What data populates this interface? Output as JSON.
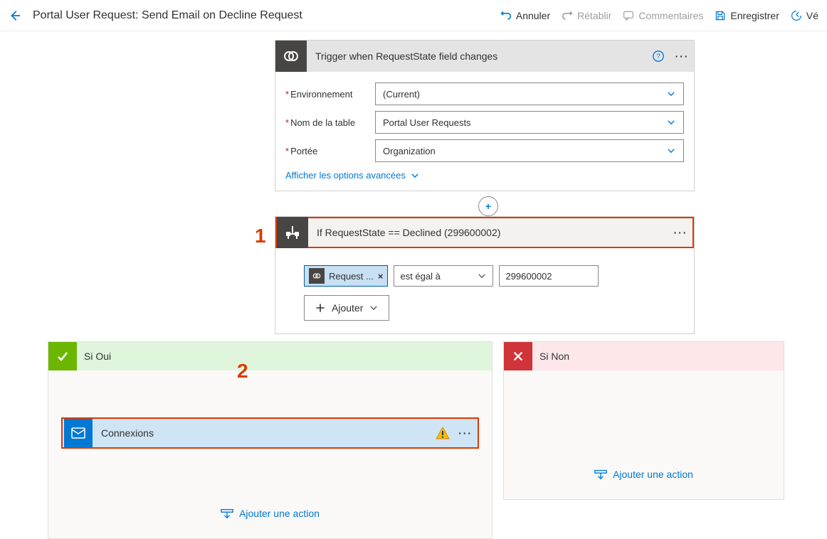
{
  "title": "Portal User Request: Send Email on Decline Request",
  "toolbar": {
    "undo": "Annuler",
    "redo": "Rétablir",
    "comments": "Commentaires",
    "save": "Enregistrer",
    "verify": "Vé"
  },
  "trigger": {
    "title": "Trigger when RequestState field changes",
    "env_label": "Environnement",
    "env_value": "(Current)",
    "table_label": "Nom de la table",
    "table_value": "Portal User Requests",
    "scope_label": "Portée",
    "scope_value": "Organization",
    "advanced": "Afficher les options avancées"
  },
  "condition": {
    "title": "If RequestState == Declined (299600002)",
    "token_label": "Request ...",
    "operator": "est égal à",
    "value": "299600002",
    "add_label": "Ajouter"
  },
  "branches": {
    "yes_title": "Si Oui",
    "no_title": "Si Non",
    "connections_label": "Connexions",
    "add_action": "Ajouter une action"
  },
  "annotations": {
    "one": "1",
    "two": "2"
  }
}
